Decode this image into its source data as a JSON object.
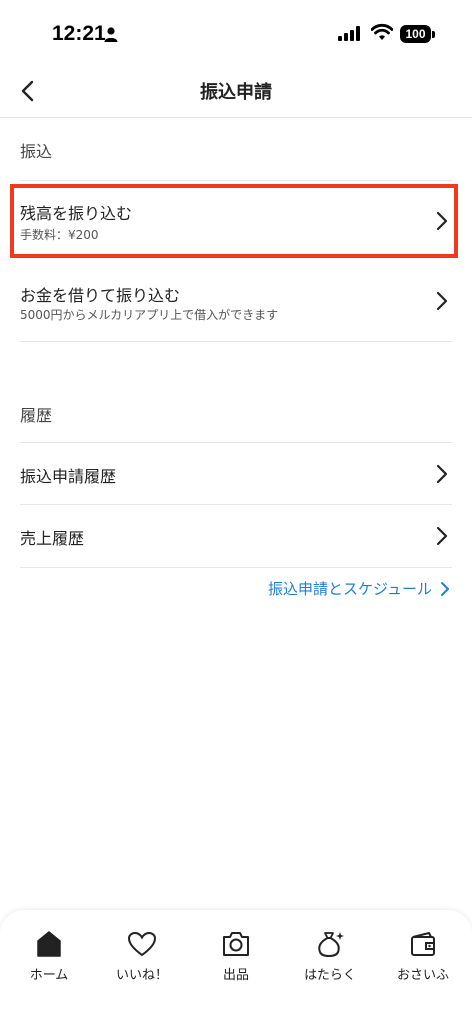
{
  "status_bar": {
    "time": "12:21",
    "battery": "100"
  },
  "nav": {
    "title": "振込申請"
  },
  "transfer_section": {
    "header": "振込",
    "items": [
      {
        "title": "残高を振り込む",
        "subtitle": "手数料：¥200"
      },
      {
        "title": "お金を借りて振り込む",
        "subtitle": "5000円からメルカリアプリ上で借入ができます"
      }
    ]
  },
  "history_section": {
    "header": "履歴",
    "items": [
      {
        "title": "振込申請履歴"
      },
      {
        "title": "売上履歴"
      }
    ]
  },
  "schedule_link": {
    "label": "振込申請とスケジュール"
  },
  "tab_bar": {
    "tabs": [
      {
        "label": "ホーム",
        "icon": "home-icon"
      },
      {
        "label": "いいね！",
        "icon": "heart-icon"
      },
      {
        "label": "出品",
        "icon": "camera-icon"
      },
      {
        "label": "はたらく",
        "icon": "money-bag-icon"
      },
      {
        "label": "おさいふ",
        "icon": "wallet-icon"
      }
    ]
  },
  "colors": {
    "highlight": "#f2381f",
    "link": "#1f7ed0",
    "text": "#222222"
  }
}
